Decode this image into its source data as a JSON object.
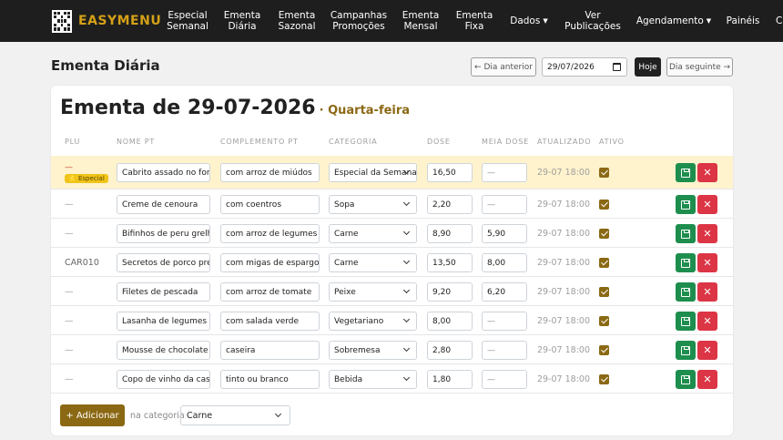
{
  "nav": {
    "brand": "EASYMENU",
    "items": [
      {
        "label": "Especial Semanal",
        "l1": "Especial",
        "l2": "Semanal"
      },
      {
        "label": "Ementa Diária",
        "l1": "Ementa",
        "l2": "Diária"
      },
      {
        "label": "Ementa Sazonal",
        "l1": "Ementa",
        "l2": "Sazonal"
      },
      {
        "label": "Campanhas Promoções",
        "l1": "Campanhas",
        "l2": "Promoções"
      },
      {
        "label": "Ementa Mensal",
        "l1": "Ementa",
        "l2": "Mensal"
      },
      {
        "label": "Ementa Fixa",
        "l1": "Ementa",
        "l2": "Fixa"
      },
      {
        "label": "Dados",
        "l1": "Dados",
        "l2": ""
      },
      {
        "label": "Ver Publicações",
        "l1": "Ver",
        "l2": "Publicações"
      },
      {
        "label": "Agendamento",
        "l1": "Agendamento",
        "l2": ""
      },
      {
        "label": "Painéis",
        "l1": "Painéis",
        "l2": ""
      },
      {
        "label": "C",
        "l1": "C",
        "l2": ""
      }
    ]
  },
  "header": {
    "title": "Ementa Diária",
    "prev_label": "← Dia anterior",
    "date_value": "29/07/2026",
    "today_label": "Hoje",
    "next_label": "Dia seguinte →"
  },
  "card": {
    "title": "Ementa de 29-07-2026",
    "weekday": "· Quarta-feira",
    "columns": {
      "plu": "PLU",
      "name": "NOME PT",
      "complement": "COMPLEMENTO PT",
      "category": "CATEGORIA",
      "dose": "DOSE",
      "half": "MEIA DOSE",
      "updated": "ATUALIZADO",
      "active": "ATIVO"
    },
    "rows": [
      {
        "plu": "—",
        "badge": "⭐ Especial",
        "name": "Cabrito assado no forno",
        "complement": "com arroz de miúdos",
        "category": "Especial da Semana",
        "dose": "16,50",
        "half": "—",
        "updated": "29-07 18:00"
      },
      {
        "plu": "—",
        "badge": "",
        "name": "Creme de cenoura",
        "complement": "com coentros",
        "category": "Sopa",
        "dose": "2,20",
        "half": "—",
        "updated": "29-07 18:00"
      },
      {
        "plu": "—",
        "badge": "",
        "name": "Bifinhos de peru grelhados",
        "complement": "com arroz de legumes",
        "category": "Carne",
        "dose": "8,90",
        "half": "5,90",
        "updated": "29-07 18:00"
      },
      {
        "plu": "CAR010",
        "badge": "",
        "name": "Secretos de porco preto",
        "complement": "com migas de espargos",
        "category": "Carne",
        "dose": "13,50",
        "half": "8,00",
        "updated": "29-07 18:00"
      },
      {
        "plu": "—",
        "badge": "",
        "name": "Filetes de pescada",
        "complement": "com arroz de tomate",
        "category": "Peixe",
        "dose": "9,20",
        "half": "6,20",
        "updated": "29-07 18:00"
      },
      {
        "plu": "—",
        "badge": "",
        "name": "Lasanha de legumes",
        "complement": "com salada verde",
        "category": "Vegetariano",
        "dose": "8,00",
        "half": "—",
        "updated": "29-07 18:00"
      },
      {
        "plu": "—",
        "badge": "",
        "name": "Mousse de chocolate",
        "complement": "caseira",
        "category": "Sobremesa",
        "dose": "2,80",
        "half": "—",
        "updated": "29-07 18:00"
      },
      {
        "plu": "—",
        "badge": "",
        "name": "Copo de vinho da casa",
        "complement": "tinto ou branco",
        "category": "Bebida",
        "dose": "1,80",
        "half": "—",
        "updated": "29-07 18:00"
      }
    ],
    "add_label": "+ Adicionar",
    "add_in_category": "na categoria",
    "add_category_value": "Carne"
  },
  "colors": {
    "navbar_bg": "#1e1e1e",
    "brand": "#d4a017",
    "accent": "#8b6914",
    "highlight_row": "#fff3cd",
    "save": "#1e8e4e",
    "delete": "#dc3545"
  }
}
